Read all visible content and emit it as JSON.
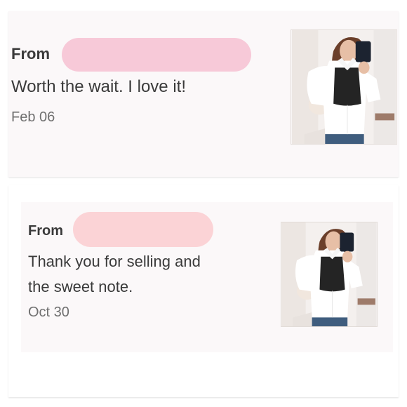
{
  "reviews": [
    {
      "from_label": "From",
      "message": "Worth the wait. I love it!",
      "date": "Feb 06",
      "redaction_color": "#f7c9d8"
    },
    {
      "from_label": "From",
      "message_line1": "Thank you for selling and",
      "message_line2": "the sweet note.",
      "date": "Oct 30",
      "redaction_color": "#fbd3d6"
    }
  ],
  "colors": {
    "card_background": "#fbf8f9",
    "text": "#3a3a3a",
    "date_text": "#6f6f6f"
  },
  "icons": [
    "product-photo-icon"
  ]
}
